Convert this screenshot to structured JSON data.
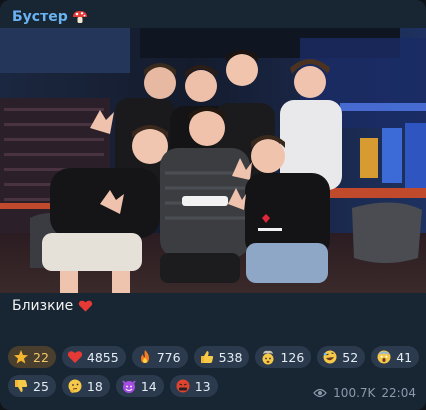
{
  "channel": {
    "name": "Бустер",
    "name_icon": "mushroom-icon"
  },
  "photo": {
    "description_icon": "group-photo"
  },
  "caption": {
    "text": "Близкие",
    "emoji": "red-heart-icon"
  },
  "reactions": [
    {
      "icon": "star-icon",
      "count": "22"
    },
    {
      "icon": "red-heart-icon",
      "count": "4855"
    },
    {
      "icon": "fire-icon",
      "count": "776"
    },
    {
      "icon": "thumbs-up-icon",
      "count": "538"
    },
    {
      "icon": "exploding-head-icon",
      "count": "126"
    },
    {
      "icon": "rofl-icon",
      "count": "52"
    },
    {
      "icon": "scream-icon",
      "count": "41"
    },
    {
      "icon": "thumbs-down-icon",
      "count": "25"
    },
    {
      "icon": "thinking-icon",
      "count": "18"
    },
    {
      "icon": "devil-icon",
      "count": "14"
    },
    {
      "icon": "cursing-icon",
      "count": "13"
    }
  ],
  "meta": {
    "views": "100.7K",
    "time": "22:04"
  },
  "colors": {
    "accent": "#6ab3f3",
    "bubble": "#182533",
    "reaction": "#2b3b4d"
  }
}
